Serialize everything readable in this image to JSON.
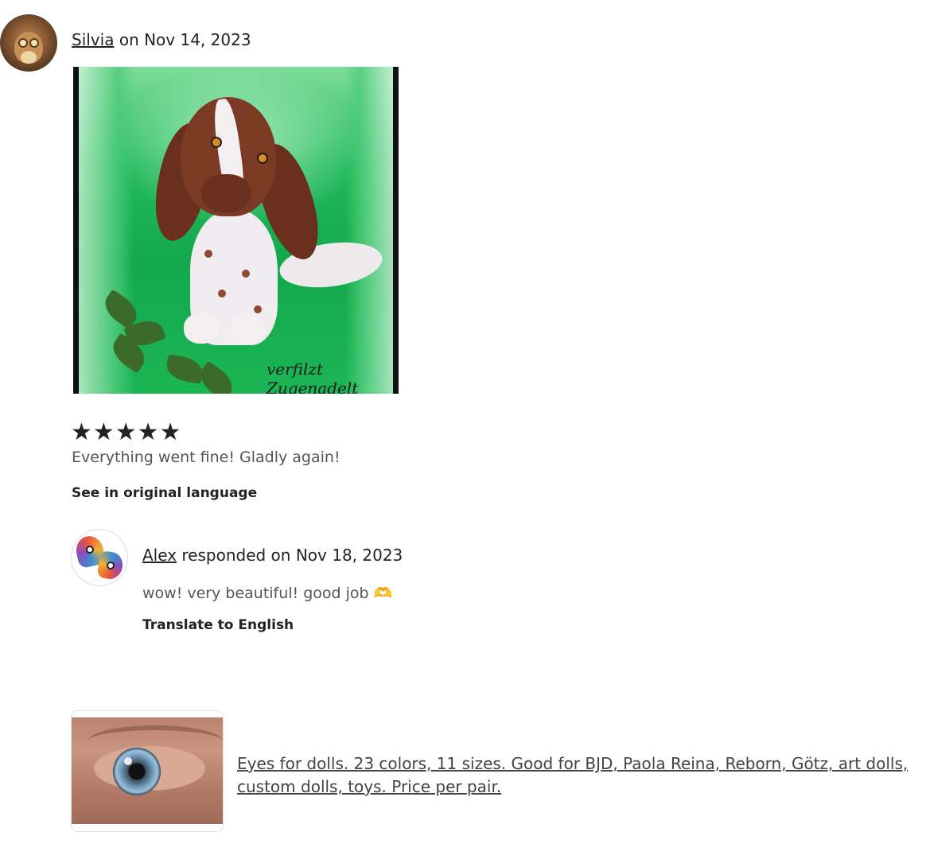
{
  "review": {
    "user": "Silvia",
    "date_prefix": " on Nov 14, 2023",
    "photo_watermark": "verfilzt Zugenadelt",
    "stars": "★★★★★",
    "rating": 5,
    "text": "Everything went fine! Gladly again!",
    "see_original": "See in original language"
  },
  "response": {
    "user": "Alex",
    "date_prefix": " responded on Nov 18, 2023",
    "text": "wow! very beautiful! good job 🫶",
    "translate": "Translate to English"
  },
  "listing": {
    "title": "Eyes for dolls. 23 colors, 11 sizes. Good for BJD, Paola Reina, Reborn, Götz, art dolls, custom dolls, toys. Price per pair."
  }
}
